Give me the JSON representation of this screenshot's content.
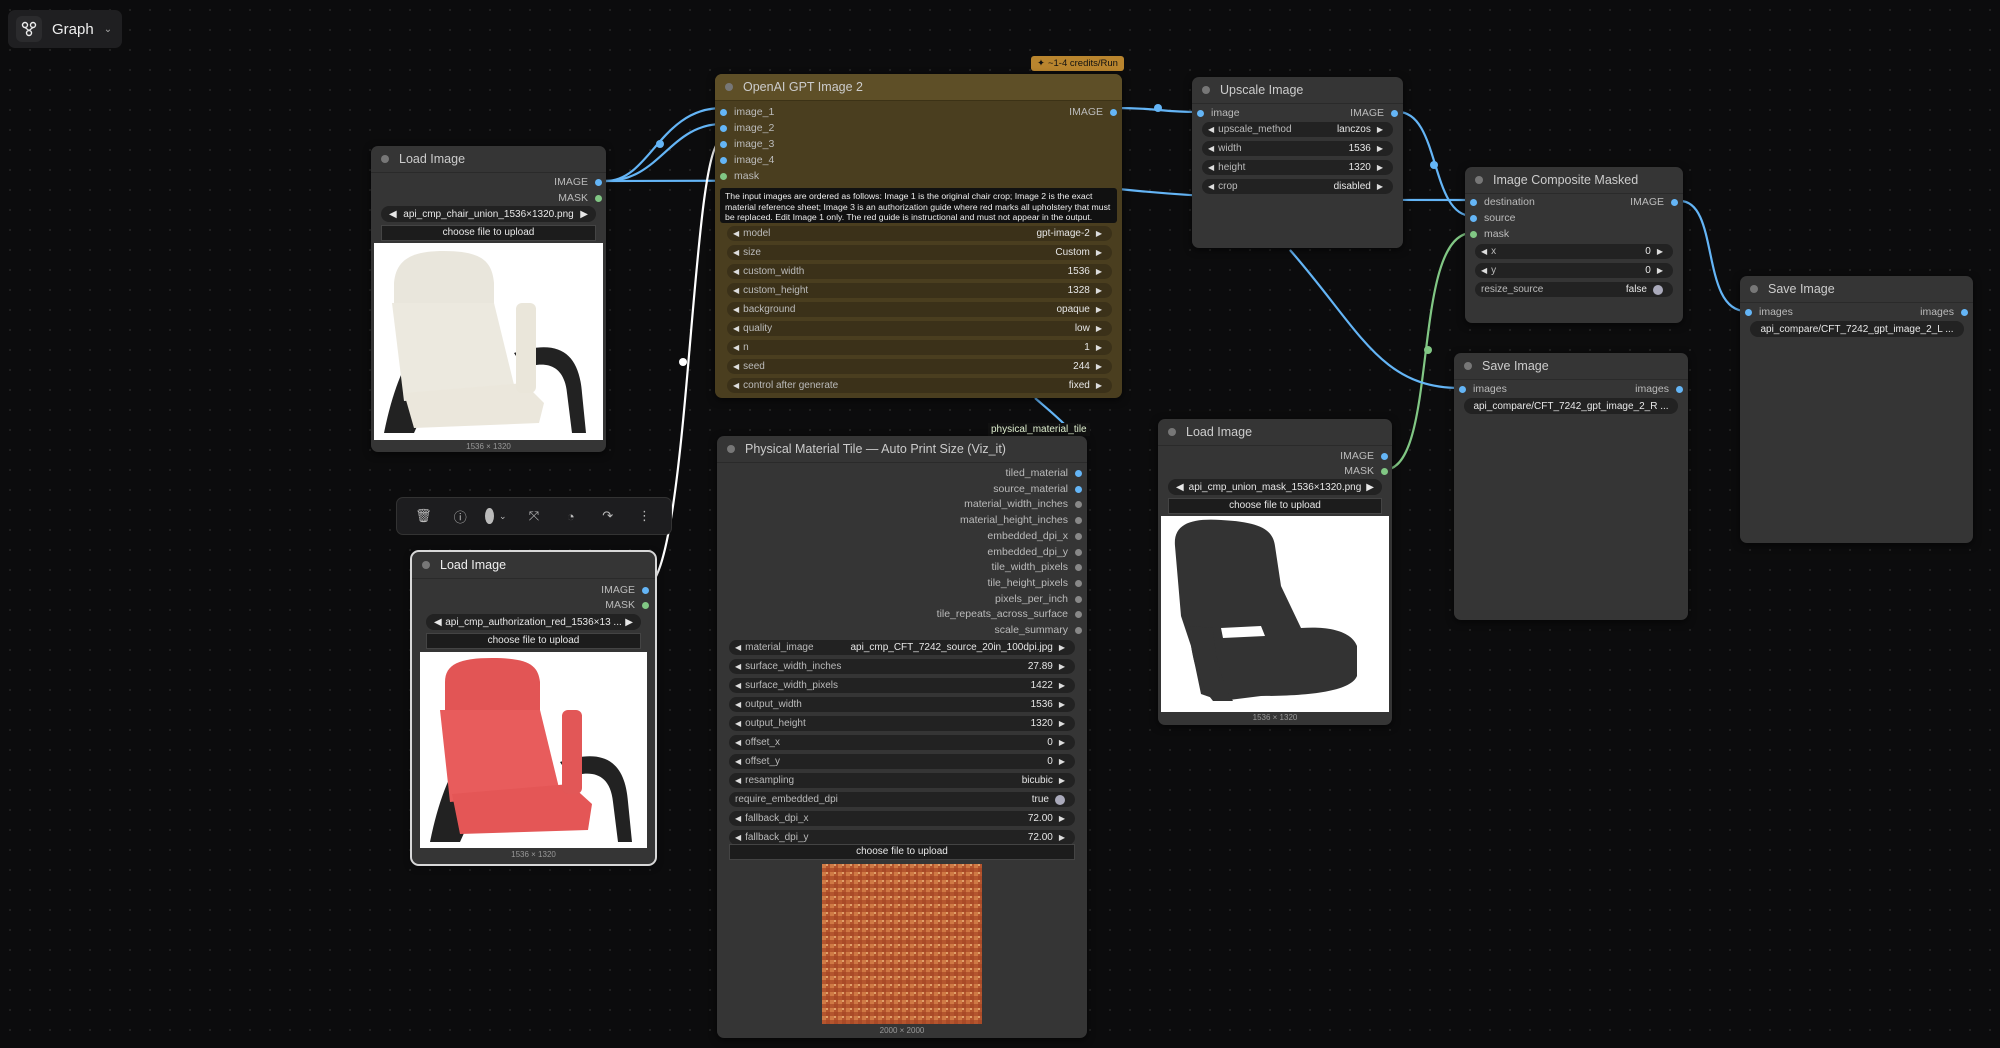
{
  "toolbar_top": {
    "graph_label": "Graph"
  },
  "credits_badge": "~1-4 credits/Run",
  "link_label": "physical_material_tile",
  "gpt_node": {
    "title": "OpenAI GPT Image 2",
    "inputs": [
      "image_1",
      "image_2",
      "image_3",
      "image_4",
      "mask"
    ],
    "output": "IMAGE",
    "prompt": "The input images are ordered as follows: Image 1 is the original chair crop; Image 2 is the exact material reference sheet; Image 3 is an authorization guide where red marks all upholstery that must be replaced. Edit Image 1 only. The red guide is instructional and must not appear in the output.",
    "widgets": [
      {
        "label": "model",
        "value": "gpt-image-2"
      },
      {
        "label": "size",
        "value": "Custom"
      },
      {
        "label": "custom_width",
        "value": "1536"
      },
      {
        "label": "custom_height",
        "value": "1328"
      },
      {
        "label": "background",
        "value": "opaque"
      },
      {
        "label": "quality",
        "value": "low"
      },
      {
        "label": "n",
        "value": "1"
      },
      {
        "label": "seed",
        "value": "244"
      },
      {
        "label": "control after generate",
        "value": "fixed"
      }
    ]
  },
  "load1": {
    "title": "Load Image",
    "out1": "IMAGE",
    "out2": "MASK",
    "file": "api_cmp_chair_union_1536×1320.png",
    "upload": "choose file to upload",
    "dims": "1536 × 1320"
  },
  "load2": {
    "title": "Load Image",
    "out1": "IMAGE",
    "out2": "MASK",
    "file": "api_cmp_authorization_red_1536×13 ...",
    "upload": "choose file to upload",
    "dims": "1536 × 1320"
  },
  "load3": {
    "title": "Load Image",
    "out1": "IMAGE",
    "out2": "MASK",
    "file": "api_cmp_union_mask_1536×1320.png",
    "upload": "choose file to upload",
    "dims": "1536 × 1320"
  },
  "upscale": {
    "title": "Upscale Image",
    "in": "image",
    "out": "IMAGE",
    "widgets": [
      {
        "label": "upscale_method",
        "value": "lanczos"
      },
      {
        "label": "width",
        "value": "1536"
      },
      {
        "label": "height",
        "value": "1320"
      },
      {
        "label": "crop",
        "value": "disabled"
      }
    ]
  },
  "composite": {
    "title": "Image Composite Masked",
    "inputs": [
      "destination",
      "source",
      "mask"
    ],
    "out": "IMAGE",
    "widgets": [
      {
        "label": "x",
        "value": "0"
      },
      {
        "label": "y",
        "value": "0"
      },
      {
        "label": "resize_source",
        "value": "false"
      }
    ]
  },
  "save1": {
    "title": "Save Image",
    "in": "images",
    "out": "images",
    "prefix": "api_compare/CFT_7242_gpt_image_2_R ..."
  },
  "save2": {
    "title": "Save Image",
    "in": "images",
    "out": "images",
    "prefix": "api_compare/CFT_7242_gpt_image_2_L ..."
  },
  "tile": {
    "title": "Physical Material Tile — Auto Print Size (Viz_it)",
    "outputs": [
      "tiled_material",
      "source_material",
      "material_width_inches",
      "material_height_inches",
      "embedded_dpi_x",
      "embedded_dpi_y",
      "tile_width_pixels",
      "tile_height_pixels",
      "pixels_per_inch",
      "tile_repeats_across_surface",
      "scale_summary"
    ],
    "widgets": [
      {
        "label": "material_image",
        "value": "api_cmp_CFT_7242_source_20in_100dpi.jpg"
      },
      {
        "label": "surface_width_inches",
        "value": "27.89"
      },
      {
        "label": "surface_width_pixels",
        "value": "1422"
      },
      {
        "label": "output_width",
        "value": "1536"
      },
      {
        "label": "output_height",
        "value": "1320"
      },
      {
        "label": "offset_x",
        "value": "0"
      },
      {
        "label": "offset_y",
        "value": "0"
      },
      {
        "label": "resampling",
        "value": "bicubic"
      },
      {
        "label": "require_embedded_dpi",
        "value": "true"
      },
      {
        "label": "fallback_dpi_x",
        "value": "72.00"
      },
      {
        "label": "fallback_dpi_y",
        "value": "72.00"
      }
    ],
    "upload": "choose file to upload",
    "dims": "2000 × 2000"
  },
  "colors": {
    "image_socket": "#64b5f6",
    "mask_socket": "#81c784",
    "gpt_header": "#5e4f27",
    "badge": "#b9852e"
  },
  "icons": [
    "graph-icon",
    "chevron-down-icon",
    "trash-icon",
    "info-icon",
    "color-dot-icon",
    "collapse-icon",
    "bypass-icon",
    "redo-icon",
    "more-icon"
  ]
}
